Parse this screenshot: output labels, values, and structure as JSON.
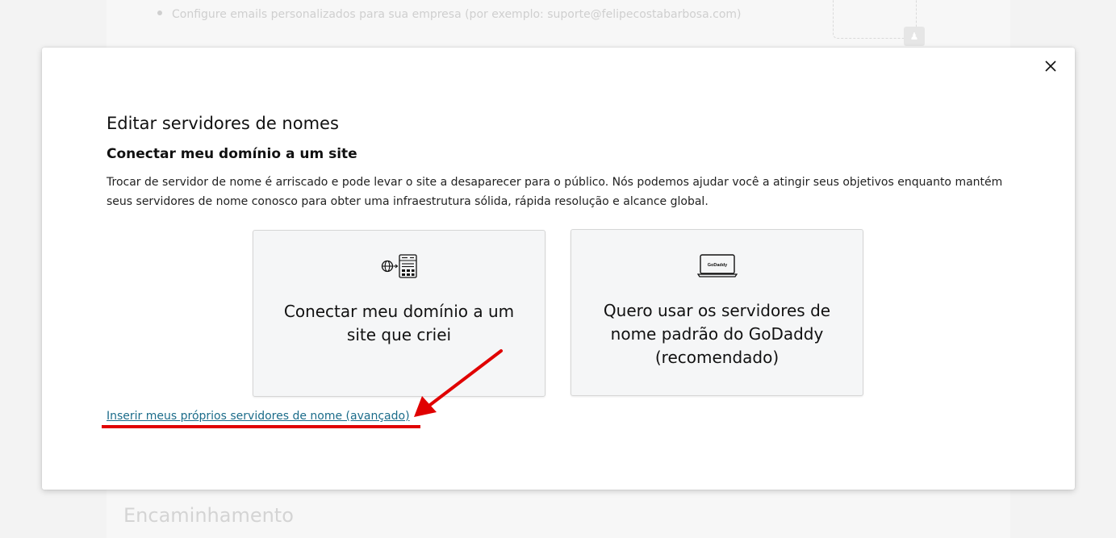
{
  "background": {
    "bullet_text": "Configure emails personalizados para sua empresa (por exemplo: suporte@felipecostabarbosa.com)",
    "section_heading": "Encaminhamento"
  },
  "modal": {
    "title": "Editar servidores de nomes",
    "subtitle": "Conectar meu domínio a um site",
    "description": "Trocar de servidor de nome é arriscado e pode levar o site a desaparecer para o público. Nós podemos ajudar você a atingir seus objetivos enquanto mantém seus servidores de nome conosco para obter uma infraestrutura sólida, rápida resolução e alcance global.",
    "close_icon": "close-icon",
    "options": [
      {
        "label": "Conectar meu domínio a um site que criei",
        "icon": "globe-website-icon"
      },
      {
        "label": "Quero usar os servidores de nome padrão do GoDaddy (recomendado)",
        "icon": "laptop-godaddy-icon",
        "icon_text": "GoDaddy"
      }
    ],
    "advanced_link": "Inserir meus próprios servidores de nome (avançado)"
  },
  "colors": {
    "link": "#1b6c8a",
    "annotation": "#e00000",
    "card_bg": "#f5f6f7"
  }
}
